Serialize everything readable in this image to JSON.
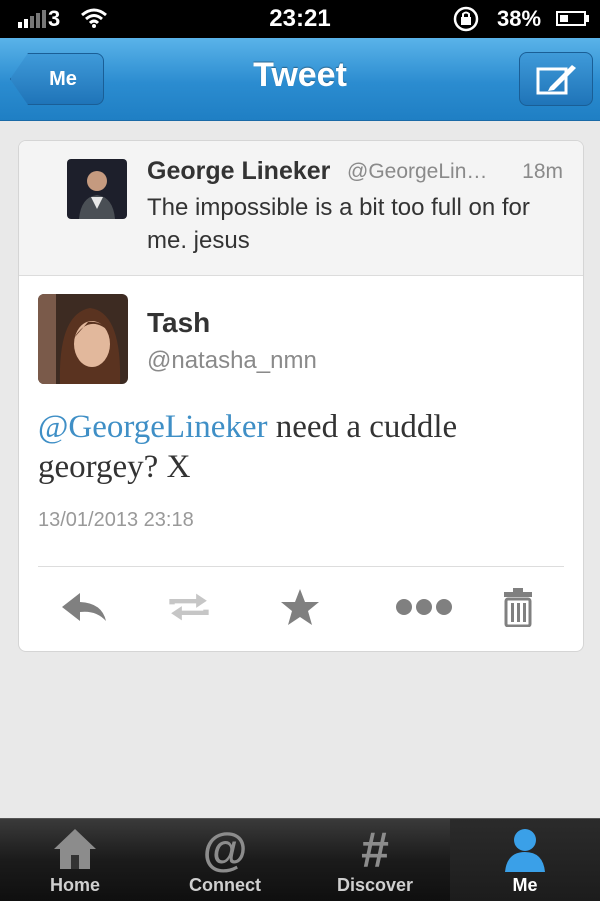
{
  "status_bar": {
    "carrier": "3",
    "time": "23:21",
    "battery_percent": "38%",
    "battery_level": 0.38
  },
  "nav": {
    "back_label": "Me",
    "title": "Tweet",
    "compose_icon": "compose-icon"
  },
  "parent_tweet": {
    "name": "George Lineker",
    "handle": "@GeorgeLin…",
    "time": "18m",
    "text": "The impossible is a bit too full on for me. jesus"
  },
  "tweet": {
    "name": "Tash",
    "handle": "@natasha_nmn",
    "mention": "@GeorgeLineker",
    "text_rest": " need a cuddle georgey? X",
    "timestamp": "13/01/2013 23:18"
  },
  "actions": [
    {
      "name": "reply-icon"
    },
    {
      "name": "retweet-icon"
    },
    {
      "name": "favorite-icon"
    },
    {
      "name": "more-icon"
    },
    {
      "name": "delete-icon"
    }
  ],
  "tabs": [
    {
      "label": "Home",
      "icon": "home-icon",
      "active": false
    },
    {
      "label": "Connect",
      "icon": "at-icon",
      "active": false
    },
    {
      "label": "Discover",
      "icon": "hashtag-icon",
      "active": false
    },
    {
      "label": "Me",
      "icon": "person-icon",
      "active": true
    }
  ],
  "colors": {
    "nav_blue": "#2b8cd0",
    "mention": "#3f8fc6",
    "active_tab": "#3aa0e8"
  }
}
